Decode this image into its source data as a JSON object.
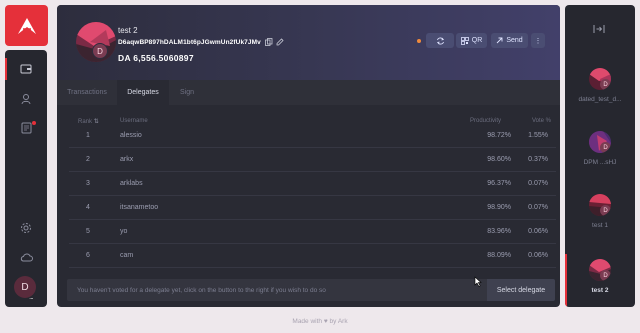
{
  "sidebar": {
    "logo": "ark-logo-icon",
    "items": [
      {
        "icon": "wallet-icon",
        "active": true
      },
      {
        "icon": "contacts-icon",
        "active": false
      },
      {
        "icon": "announcements-icon",
        "active": false,
        "badge": true
      },
      {
        "icon": "settings-icon",
        "active": false
      },
      {
        "icon": "network-icon",
        "active": false
      }
    ],
    "avatar_letter": "D",
    "more": "..."
  },
  "wallet": {
    "name": "test 2",
    "address": "D6aqwBP897hDALM1bt6pJGwmUn2fUk7JMv",
    "balance": "DA 6,556.5060897",
    "avatar_letter": "D",
    "buttons": {
      "refresh": "",
      "qr": "QR",
      "send": "Send",
      "menu": "⋮"
    }
  },
  "tabs": [
    {
      "label": "Transactions",
      "active": false
    },
    {
      "label": "Delegates",
      "active": true
    },
    {
      "label": "Sign",
      "active": false
    }
  ],
  "delegates": {
    "headers": {
      "rank": "Rank",
      "username": "Username",
      "productivity": "Productivity",
      "vote": "Vote %"
    },
    "rows": [
      {
        "rank": "1",
        "username": "alessio",
        "productivity": "98.72%",
        "vote": "1.55%"
      },
      {
        "rank": "2",
        "username": "arkx",
        "productivity": "98.60%",
        "vote": "0.37%"
      },
      {
        "rank": "3",
        "username": "arklabs",
        "productivity": "96.37%",
        "vote": "0.07%"
      },
      {
        "rank": "4",
        "username": "itsanametoo",
        "productivity": "98.90%",
        "vote": "0.07%"
      },
      {
        "rank": "5",
        "username": "yo",
        "productivity": "83.96%",
        "vote": "0.06%"
      },
      {
        "rank": "6",
        "username": "cam",
        "productivity": "88.09%",
        "vote": "0.06%"
      }
    ],
    "vote_message": "You haven't voted for a delegate yet, click on the button to the right if you wish to do so",
    "select_button": "Select delegate"
  },
  "wallets_sidebar": {
    "wallets": [
      {
        "label": "dated_test_d...",
        "letter": "D",
        "active": false
      },
      {
        "label": "DPM ...sHJ",
        "letter": "D",
        "active": false
      },
      {
        "label": "test 1",
        "letter": "D",
        "active": false
      },
      {
        "label": "test 2",
        "letter": "D",
        "active": true
      }
    ]
  },
  "footer": {
    "text": "Made with ♥ by Ark"
  },
  "colors": {
    "accent": "#e5303a",
    "panel": "#292a33",
    "button": "#4a4d72"
  }
}
